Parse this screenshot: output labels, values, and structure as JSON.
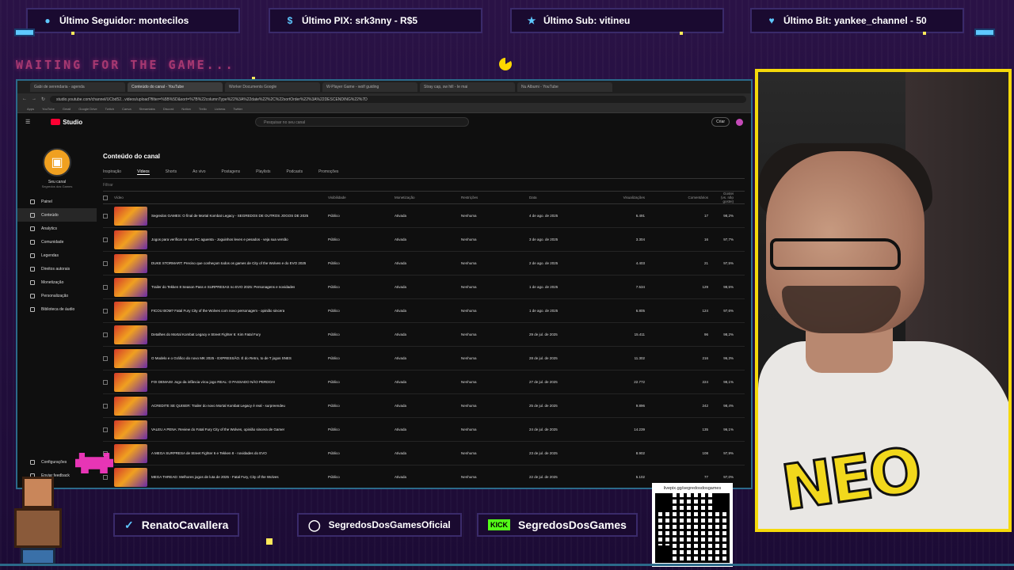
{
  "alerts": [
    {
      "label": "Último Seguidor: montecilos",
      "icon": "user-icon"
    },
    {
      "label": "Último PIX: srk3nny - R$5",
      "icon": "dollar-icon"
    },
    {
      "label": "Último Sub: vitineu",
      "icon": "star-icon"
    },
    {
      "label": "Último Bit: yankee_channel - 50",
      "icon": "heart-icon"
    }
  ],
  "overlay": {
    "waiting_text": "WAITING FOR THE GAME...",
    "accent_color": "#5ec8ff",
    "cam_border_color": "#f5d90a"
  },
  "browser": {
    "tabs": [
      "Gabi de serendaria - agenda",
      "Conteúdo do canal - YouTube",
      "Worker Documents Google",
      "W-Player Game - wolf guiding",
      "Stray cap, sw hill - le mai",
      "Nu Albumi - YouTube"
    ],
    "url": "studio.youtube.com/channel/UCbd52...videos/upload?filter=%5B%5D&sort=%7B%22columnType%22%3A%22date%22%2C%22sortOrder%22%3A%22DESCENDING%22%7D",
    "bookmarks": [
      "Apps",
      "YouTube",
      "Gmail",
      "Google Drive",
      "Twitch",
      "Canva",
      "Streamlabs",
      "Discord",
      "Notion",
      "Trello",
      "Lichess",
      "Twitter"
    ]
  },
  "studio": {
    "logo": "Studio",
    "search_placeholder": "Pesquisar no seu canal",
    "create_label": "Criar",
    "channel_name": "Seu canal",
    "channel_sub": "Segredos dos Games",
    "nav": [
      "Painel",
      "Conteúdo",
      "Analytics",
      "Comunidade",
      "Legendas",
      "Direitos autorais",
      "Monetização",
      "Personalização",
      "Biblioteca de áudio"
    ],
    "nav_bottom": [
      "Configurações",
      "Enviar feedback"
    ],
    "page_title": "Conteúdo do canal",
    "content_tabs": [
      "Inspiração",
      "Vídeos",
      "Shorts",
      "Ao vivo",
      "Postagens",
      "Playlists",
      "Podcasts",
      "Promoções"
    ],
    "filter_label": "Filtrar",
    "columns": [
      "Vídeo",
      "Visibilidade",
      "Monetização",
      "Restrições",
      "Data",
      "Visualizações",
      "Comentários",
      "Gostei (vs. não gostei)"
    ],
    "rows": [
      {
        "title": "Segredos GAMES: O final de Mortal Kombat Legacy - SEGREDOS DE OUTROS JOGOS DE 2025",
        "visibility": "Público",
        "monetization": "Ativada",
        "restrictions": "Nenhuma",
        "date": "4 de ago. de 2025",
        "views": "6.491",
        "comments": "17",
        "likes": "98,2%"
      },
      {
        "title": "Jogos para verificar se seu PC aguenta - Joguinhos leves e pesados - veja sua versão",
        "visibility": "Público",
        "monetization": "Ativada",
        "restrictions": "Nenhuma",
        "date": "3 de ago. de 2025",
        "views": "3.304",
        "comments": "16",
        "likes": "97,7%"
      },
      {
        "title": "DUKE STORMART: Preciso que conheçam todos os games de City of the Wolves e do EVO 2025",
        "visibility": "Público",
        "monetization": "Ativada",
        "restrictions": "Nenhuma",
        "date": "2 de ago. de 2025",
        "views": "4.403",
        "comments": "21",
        "likes": "97,5%"
      },
      {
        "title": "Trailer do Tekken 8 Season Pass e SURPRESAS no EVO 2025: Personagens e novidades",
        "visibility": "Público",
        "monetization": "Ativada",
        "restrictions": "Nenhuma",
        "date": "1 de ago. de 2025",
        "views": "7.534",
        "comments": "129",
        "likes": "98,5%"
      },
      {
        "title": "FICOU BOM? Fatal Fury City of the Wolves com novo personagem - opinião sincera",
        "visibility": "Público",
        "monetization": "Ativada",
        "restrictions": "Nenhuma",
        "date": "1 de ago. de 2025",
        "views": "6.805",
        "comments": "124",
        "likes": "97,6%"
      },
      {
        "title": "Detalhes do Mortal Kombat Legacy e Street Fighter 6: Kim Fatal Fury",
        "visibility": "Público",
        "monetization": "Ativada",
        "restrictions": "Nenhuma",
        "date": "29 de jul. de 2025",
        "views": "15.411",
        "comments": "96",
        "likes": "98,2%"
      },
      {
        "title": "O Modelo e o Gráfico do novo MK 2025 - EXPRESSÃO. É do Retro, to de T jogos SNES",
        "visibility": "Público",
        "monetization": "Ativada",
        "restrictions": "Nenhuma",
        "date": "28 de jul. de 2025",
        "views": "11.302",
        "comments": "216",
        "likes": "96,3%"
      },
      {
        "title": "FOI DEMAIS! Jogo da infância virou jogo REAL: O PASSADO NÃO PERDOA!",
        "visibility": "Público",
        "monetization": "Ativada",
        "restrictions": "Nenhuma",
        "date": "27 de jul. de 2025",
        "views": "22.772",
        "comments": "224",
        "likes": "98,1%"
      },
      {
        "title": "ACREDITE SE QUISER: Trailer do novo Mortal Kombat Legacy é real - surpreendeu",
        "visibility": "Público",
        "monetization": "Ativada",
        "restrictions": "Nenhuma",
        "date": "25 de jul. de 2025",
        "views": "9.896",
        "comments": "242",
        "likes": "98,4%"
      },
      {
        "title": "VALEU A PENA: Review do Fatal Fury City of the Wolves, opinião sincera de Gamer",
        "visibility": "Público",
        "monetization": "Ativada",
        "restrictions": "Nenhuma",
        "date": "24 de jul. de 2025",
        "views": "14.239",
        "comments": "135",
        "likes": "96,1%"
      },
      {
        "title": "A MEGA SURPRESA de Street Fighter 6 e Tekken 8 - novidades do EVO",
        "visibility": "Público",
        "monetization": "Ativada",
        "restrictions": "Nenhuma",
        "date": "23 de jul. de 2025",
        "views": "8.902",
        "comments": "108",
        "likes": "97,9%"
      },
      {
        "title": "MEGA THREAD: Melhores jogos de luta de 2025 - Fatal Fury, City of the Wolves",
        "visibility": "Público",
        "monetization": "Ativada",
        "restrictions": "Nenhuma",
        "date": "22 de jul. de 2025",
        "views": "5.102",
        "comments": "77",
        "likes": "97,0%"
      }
    ]
  },
  "social": {
    "twitter": "RenatoCavallera",
    "instagram": "SegredosDosGamesOficial",
    "kick_badge": "KICK",
    "kick": "SegredosDosGames",
    "qr_url": "livepix.gg/segredosdosgames"
  },
  "shirt_text": "NEO"
}
